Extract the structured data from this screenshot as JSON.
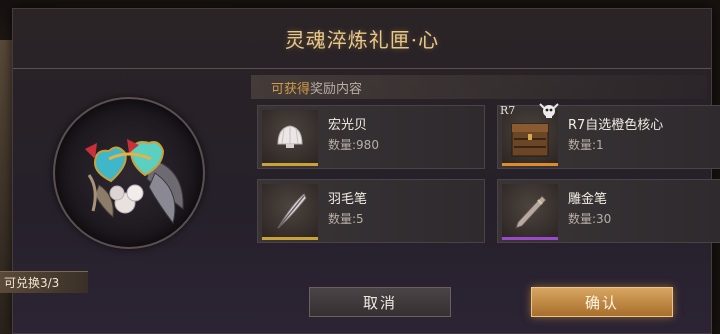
{
  "dialog": {
    "title": "灵魂淬炼礼匣·心",
    "exchange_count": "可兑换3/3",
    "rewards_header": {
      "highlight": "可获得",
      "rest": "奖励内容"
    },
    "rewards": [
      {
        "name": "宏光贝",
        "quantity": "数量:980",
        "rarity_color": "#c9a23a",
        "icon": "shell-icon"
      },
      {
        "name": "R7自选橙色核心",
        "quantity": "数量:1",
        "rank": "R7",
        "rarity_color": "#e08a2a",
        "icon": "treasure-chest-icon"
      },
      {
        "name": "羽毛笔",
        "quantity": "数量:5",
        "rarity_color": "#c9a23a",
        "icon": "feather-quill-icon"
      },
      {
        "name": "雕金笔",
        "quantity": "数量:30",
        "rarity_color": "#9a4ac9",
        "icon": "carving-pen-icon"
      }
    ],
    "buttons": {
      "cancel": "取消",
      "confirm": "确认"
    }
  }
}
